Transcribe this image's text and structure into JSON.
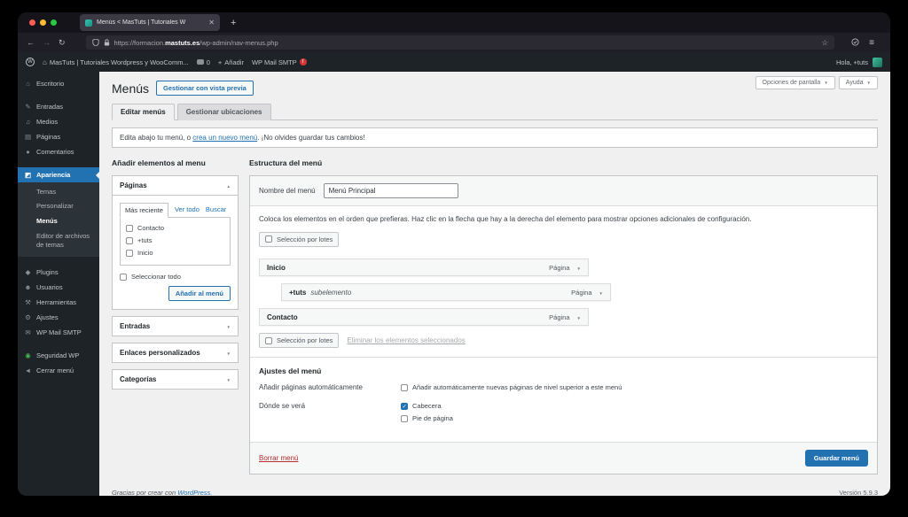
{
  "browser": {
    "tab_title": "Menús < MasTuts | Tutoriales W",
    "close_glyph": "✕",
    "new_tab": "+",
    "url_prefix": "https://formacion.",
    "url_domain": "mastuts.es",
    "url_path": "/wp-admin/nav-menus.php",
    "back": "←",
    "forward": "→",
    "reload": "↻",
    "star": "☆",
    "menu": "≡"
  },
  "admin_bar": {
    "wp": "W",
    "home_icon": "⌂",
    "site_name": "MasTuts | Tutoriales Wordpress y WooComm...",
    "comments_count": "0",
    "plus": "+",
    "new_label": "Añadir",
    "smtp_label": "WP Mail SMTP",
    "smtp_badge": "!",
    "greeting": "Hola, +tuts"
  },
  "sidebar": {
    "items": [
      {
        "label": "Escritorio",
        "icon": "⌂"
      },
      {
        "label": "Entradas",
        "icon": "✎"
      },
      {
        "label": "Medios",
        "icon": "♫"
      },
      {
        "label": "Páginas",
        "icon": "▤"
      },
      {
        "label": "Comentarios",
        "icon": "●"
      },
      {
        "label": "Apariencia",
        "icon": "◩"
      },
      {
        "label": "Plugins",
        "icon": "◆"
      },
      {
        "label": "Usuarios",
        "icon": "☻"
      },
      {
        "label": "Herramientas",
        "icon": "⚒"
      },
      {
        "label": "Ajustes",
        "icon": "⚙"
      },
      {
        "label": "WP Mail SMTP",
        "icon": "✉"
      },
      {
        "label": "Seguridad WP",
        "icon": "◉"
      },
      {
        "label": "Cerrar menú",
        "icon": "◄"
      }
    ],
    "appearance_submenu": [
      {
        "label": "Temas"
      },
      {
        "label": "Personalizar"
      },
      {
        "label": "Menús"
      },
      {
        "label": "Editor de archivos de temas"
      }
    ]
  },
  "toolbar": {
    "screen_options": "Opciones de pantalla",
    "help": "Ayuda"
  },
  "page": {
    "title": "Menús",
    "preview_button": "Gestionar con vista previa",
    "tabs": [
      {
        "label": "Editar menús"
      },
      {
        "label": "Gestionar ubicaciones"
      }
    ],
    "notice_pre": "Edita abajo tu menú, o ",
    "notice_link": "crea un nuevo menú",
    "notice_post": ". ¡No olvides guardar tus cambios!"
  },
  "add_items": {
    "title": "Añadir elementos al menu",
    "pages": {
      "title": "Páginas",
      "tab_recent": "Más reciente",
      "tab_all": "Ver todo",
      "tab_search": "Buscar",
      "items": [
        {
          "label": "Contacto"
        },
        {
          "label": "+tuts"
        },
        {
          "label": "Inicio"
        }
      ],
      "select_all": "Seleccionar todo",
      "add_button": "Añadir al menú"
    },
    "collapsed": [
      {
        "title": "Entradas"
      },
      {
        "title": "Enlaces personalizados"
      },
      {
        "title": "Categorías"
      }
    ]
  },
  "structure": {
    "title": "Estructura del menú",
    "name_label": "Nombre del menú",
    "name_value": "Menú Principal",
    "help_text": "Coloca los elementos en el orden que prefieras. Haz clic en la flecha que hay a la derecha del elemento para mostrar opciones adicionales de configuración.",
    "bulk_select": "Selección por lotes",
    "items": [
      {
        "label": "Inicio",
        "type": "Página"
      },
      {
        "label": "+tuts",
        "sub_label": "subelemento",
        "type": "Página"
      },
      {
        "label": "Contacto",
        "type": "Página"
      }
    ],
    "remove_link": "Eliminar los elementos seleccionados",
    "settings_title": "Ajustes del menú",
    "auto_add_label": "Añadir páginas automáticamente",
    "auto_add_option": "Añadir automáticamente nuevas páginas de nivel superior a este menú",
    "where_label": "Dónde se verá",
    "loc_header": "Cabecera",
    "loc_footer": "Pie de página",
    "delete_link": "Borrar menú",
    "save_button": "Guardar menú"
  },
  "footer": {
    "thanks_pre": "Gracias por crear con ",
    "thanks_link": "WordPress.",
    "version": "Versión 5.9.3"
  },
  "colors": {
    "accent": "#2271b1",
    "admin_dark": "#1d2327",
    "badge_red": "#d63638",
    "delete_red": "#b32d2e"
  }
}
